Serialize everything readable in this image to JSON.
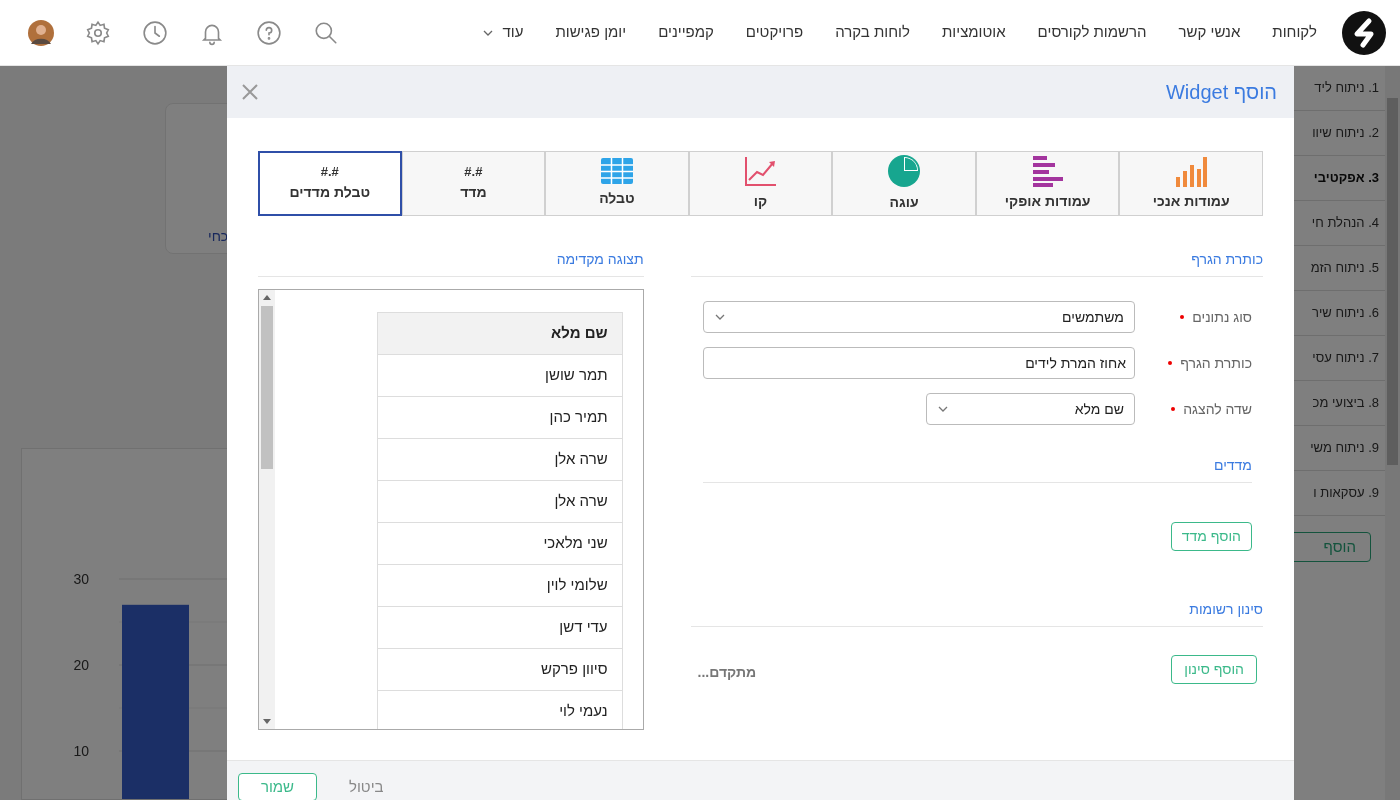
{
  "navbar": {
    "items": [
      "לקוחות",
      "אנשי קשר",
      "הרשמות לקורסים",
      "אוטומציות",
      "לוחות בקרה",
      "פרויקטים",
      "קמפיינים",
      "יומן פגישות"
    ],
    "more": "עוד"
  },
  "background": {
    "card_link": "כחי",
    "reports": [
      {
        "label": "1. ניתוח ליד",
        "selected": false
      },
      {
        "label": "2. ניתוח שיוו",
        "selected": false
      },
      {
        "label": "3. אפקטיבי",
        "selected": true
      },
      {
        "label": "4. הנהלת חי",
        "selected": false
      },
      {
        "label": "5. ניתוח הזמ",
        "selected": false
      },
      {
        "label": "6. ניתוח שיר",
        "selected": false
      },
      {
        "label": "7. ניתוח עסי",
        "selected": false
      },
      {
        "label": "8. ביצועי מכ",
        "selected": false
      },
      {
        "label": "9. ניתוח משי",
        "selected": false
      },
      {
        "label": "9. עסקאות ו",
        "selected": false
      }
    ],
    "add_button": "הוסף",
    "chart_data": {
      "type": "bar",
      "ylim": [
        4.4,
        30
      ],
      "grid": true,
      "yticks": [
        10,
        20,
        30
      ],
      "series": [
        {
          "color": "#365ecc",
          "values": [
            27
          ]
        }
      ]
    }
  },
  "modal": {
    "title": "הוסף Widget",
    "chart_types": [
      {
        "kind": "vbar",
        "label": "עמודות אנכי",
        "selected": false
      },
      {
        "kind": "hbar",
        "label": "עמודות אופקי",
        "selected": false
      },
      {
        "kind": "pie",
        "label": "עוגה",
        "selected": false
      },
      {
        "kind": "line",
        "label": "קו",
        "selected": false
      },
      {
        "kind": "table",
        "label": "טבלה",
        "selected": false
      },
      {
        "kind": "metric",
        "symbol": "#.#",
        "label": "מדד",
        "selected": false
      },
      {
        "kind": "metric",
        "symbol": "#.#",
        "label": "טבלת מדדים",
        "selected": true
      }
    ],
    "form": {
      "title": "כותרת הגרף",
      "fields": [
        {
          "kind": "select",
          "label": "סוג נתונים",
          "required": true,
          "value": "משתמשים"
        },
        {
          "kind": "text",
          "label": "כותרת הגרף",
          "required": true,
          "value": "אחוז המרת לידים"
        },
        {
          "kind": "select_short",
          "label": "שדה להצגה",
          "required": true,
          "value": "שם מלא"
        }
      ]
    },
    "metrics": {
      "title": "מדדים",
      "add_button": "הוסף מדד"
    },
    "filters": {
      "title": "סינון רשומות",
      "add_button": "הוסף סינון",
      "advanced": "מתקדם..."
    },
    "preview": {
      "title": "תצוגה מקדימה",
      "column": "שם מלא",
      "rows": [
        "תמר שושן",
        "תמיר כהן",
        "שרה אלן",
        "שרה אלן",
        "שני מלאכי",
        "שלומי לוין",
        "עדי דשן",
        "סיוון פרקש",
        "נעמי לוי"
      ]
    },
    "footer": {
      "save": "שמור",
      "cancel": "ביטול"
    }
  }
}
